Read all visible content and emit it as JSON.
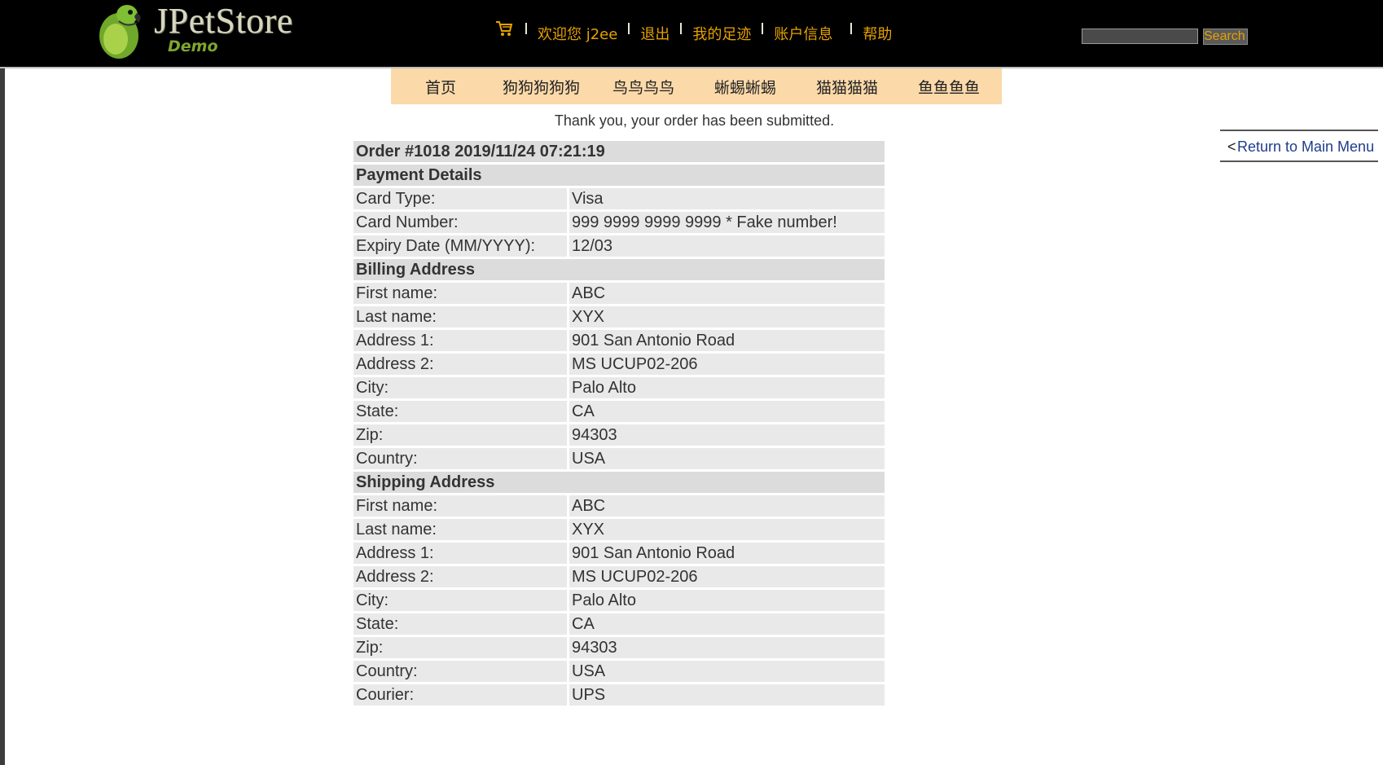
{
  "header": {
    "logo_title": "JPetStore",
    "logo_subtitle": "Demo",
    "menu": [
      "欢迎您 j2ee",
      "退出",
      "我的足迹",
      "账户信息",
      "帮助"
    ],
    "search_placeholder": "",
    "search_button": "Search",
    "colors": {
      "background": "#000000",
      "link": "#e6a100"
    }
  },
  "categories": [
    "首页",
    "狗狗狗狗狗",
    "鸟鸟鸟鸟",
    "蜥蜴蜥蜴",
    "猫猫猫猫",
    "鱼鱼鱼鱼"
  ],
  "category_bar_color": "#fbd9a9",
  "return_link": {
    "prefix": "<",
    "label": "Return to Main Menu"
  },
  "message": "Thank you, your order has been submitted.",
  "order": {
    "title": "Order #1018 2019/11/24 07:21:19",
    "payment": {
      "heading": "Payment Details",
      "rows": [
        {
          "label": "Card Type:",
          "value": "Visa"
        },
        {
          "label": "Card Number:",
          "value": "999 9999 9999 9999 * Fake number!"
        },
        {
          "label": "Expiry Date (MM/YYYY):",
          "value": "12/03"
        }
      ]
    },
    "billing": {
      "heading": "Billing Address",
      "rows": [
        {
          "label": "First name:",
          "value": "ABC"
        },
        {
          "label": "Last name:",
          "value": "XYX"
        },
        {
          "label": "Address 1:",
          "value": "901 San Antonio Road"
        },
        {
          "label": "Address 2:",
          "value": "MS UCUP02-206"
        },
        {
          "label": "City:",
          "value": "Palo Alto"
        },
        {
          "label": "State:",
          "value": "CA"
        },
        {
          "label": "Zip:",
          "value": "94303"
        },
        {
          "label": "Country:",
          "value": "USA"
        }
      ]
    },
    "shipping": {
      "heading": "Shipping Address",
      "rows": [
        {
          "label": "First name:",
          "value": "ABC"
        },
        {
          "label": "Last name:",
          "value": "XYX"
        },
        {
          "label": "Address 1:",
          "value": "901 San Antonio Road"
        },
        {
          "label": "Address 2:",
          "value": "MS UCUP02-206"
        },
        {
          "label": "City:",
          "value": "Palo Alto"
        },
        {
          "label": "State:",
          "value": "CA"
        },
        {
          "label": "Zip:",
          "value": "94303"
        },
        {
          "label": "Country:",
          "value": "USA"
        },
        {
          "label": "Courier:",
          "value": "UPS"
        }
      ]
    }
  }
}
